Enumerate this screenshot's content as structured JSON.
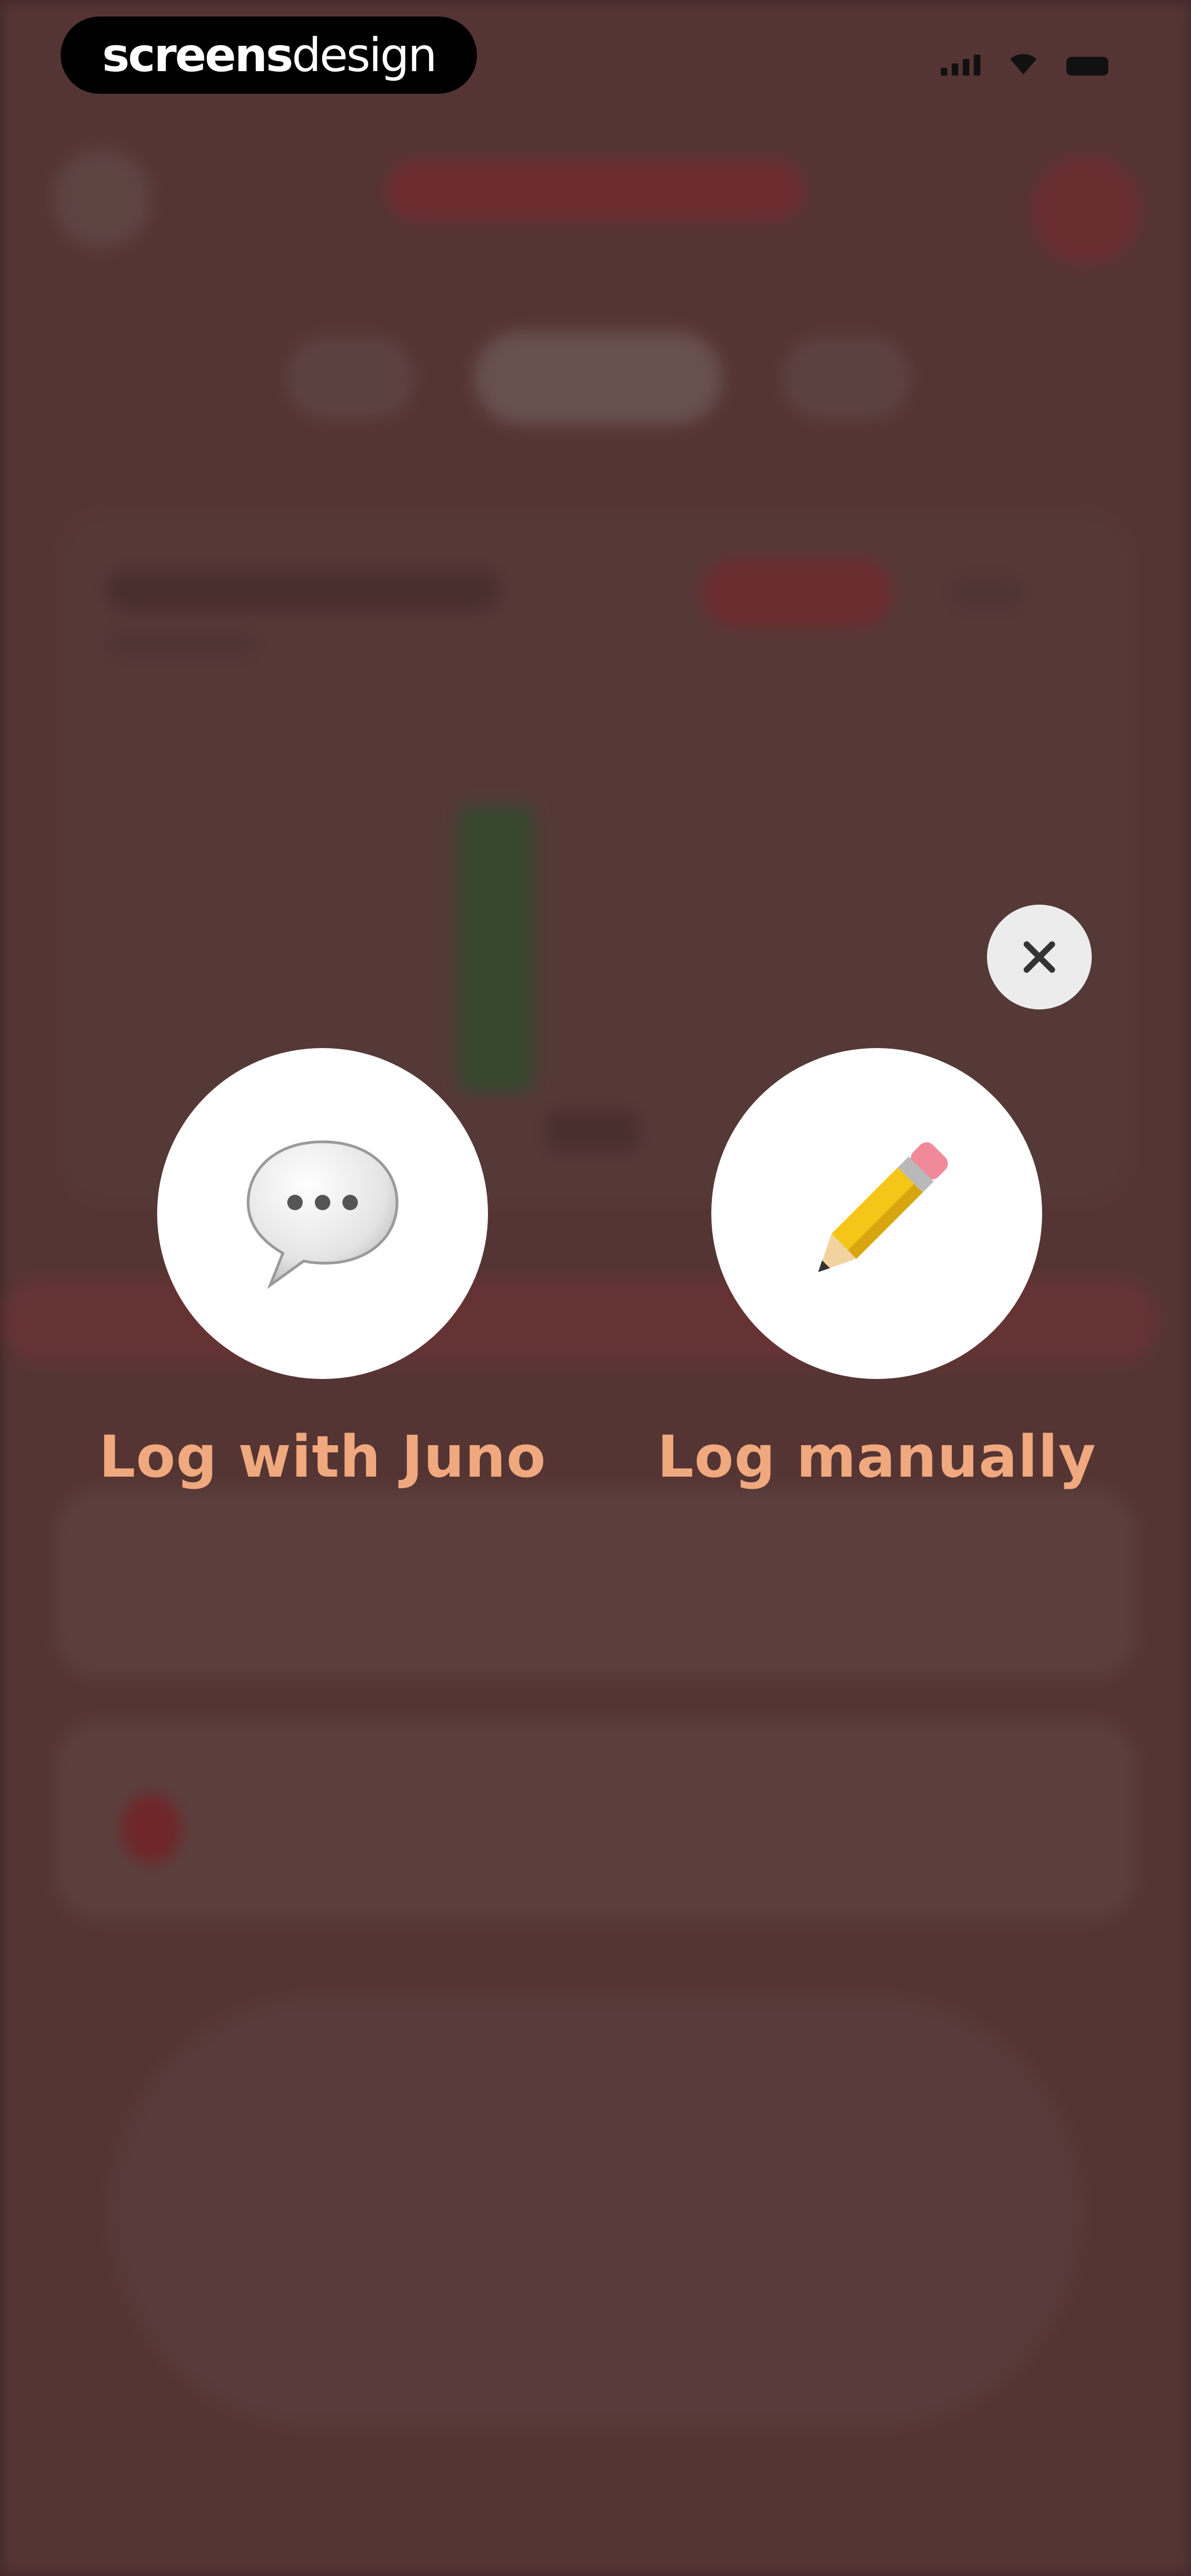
{
  "status_bar": {
    "brand_bold": "screens",
    "brand_light": "design"
  },
  "modal": {
    "close_icon": "close-icon",
    "options": [
      {
        "label": "Log with Juno",
        "icon": "speech-bubble-icon"
      },
      {
        "label": "Log manually",
        "icon": "pencil-icon"
      }
    ]
  },
  "colors": {
    "label": "#f0a87e",
    "overlay": "#4a3232",
    "circle": "#ffffff"
  }
}
